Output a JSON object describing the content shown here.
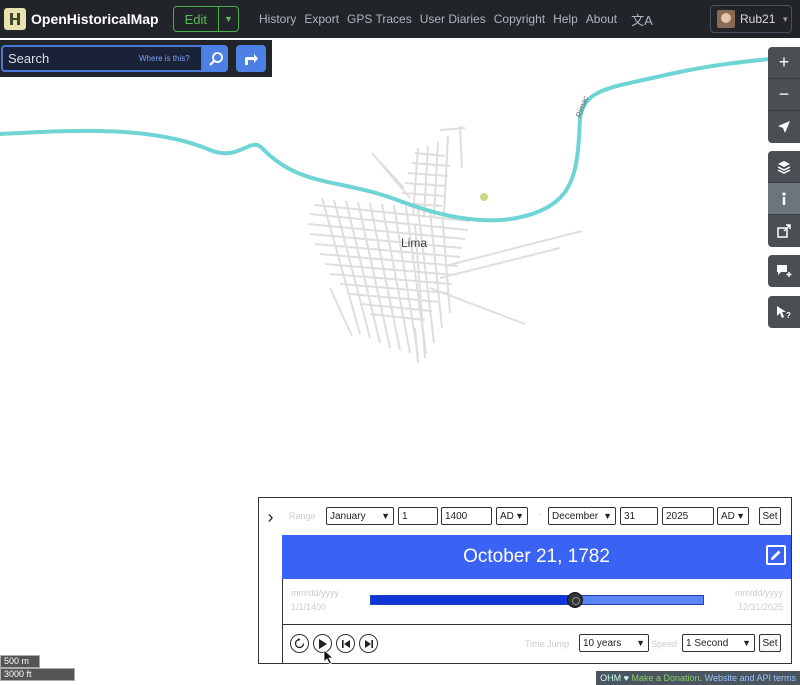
{
  "navbar": {
    "brand": "OpenHistoricalMap",
    "edit_label": "Edit",
    "links": [
      "History",
      "Export",
      "GPS Traces",
      "User Diaries",
      "Copyright",
      "Help",
      "About"
    ],
    "language_icon": "translate-icon",
    "user_name": "Rub21"
  },
  "search": {
    "placeholder": "Search",
    "where_label": "Where is this?",
    "go_icon": "magnifier-icon",
    "directions_icon": "directions-icon"
  },
  "map": {
    "place_label": "Lima",
    "river_label": "Rimac"
  },
  "controls": {
    "zoom_in": "+",
    "zoom_out": "−"
  },
  "scale": {
    "metric": "500 m",
    "imperial": "3000 ft"
  },
  "attribution": {
    "ohm": "OHM ♥",
    "donate": "Make a Donation",
    "sep": ".",
    "terms": "Website and API terms"
  },
  "time_slider": {
    "range_label": "Range",
    "start_month": "January",
    "start_day": "1",
    "start_year": "1400",
    "start_era": "AD",
    "end_month": "December",
    "end_day": "31",
    "end_year": "2025",
    "end_era": "AD",
    "set_label": "Set",
    "current_date": "October 21, 1782",
    "date_format_left": "mm/dd/yyyy",
    "min_date": "1/1/1400",
    "date_format_right": "mm/dd/yyyy",
    "max_date": "12/31/2025",
    "position_fraction": 0.613,
    "time_jump_label": "Time Jump",
    "time_jump_value": "10 years",
    "speed_label": "Speed",
    "speed_value": "1 Second",
    "set_label_2": "Set"
  },
  "colors": {
    "river": "#6fd4d4",
    "accent": "#3a62f5",
    "navbar": "#212529",
    "edit_green": "#5cb85c"
  }
}
